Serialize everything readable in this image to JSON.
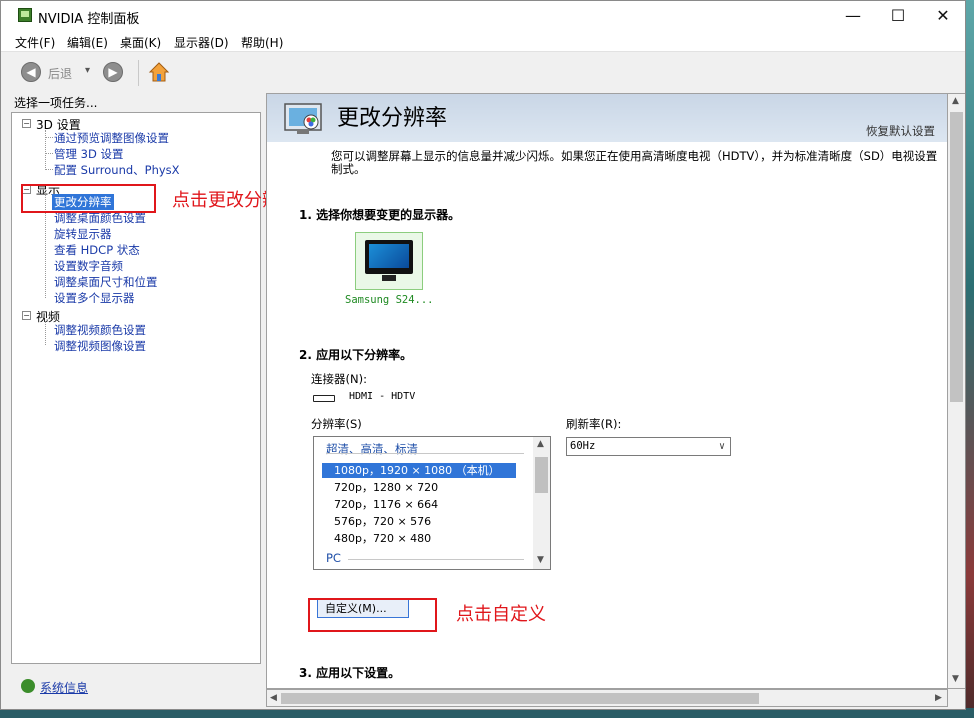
{
  "window": {
    "title": "NVIDIA 控制面板"
  },
  "titlebar_buttons": {
    "minimize": "—",
    "maximize": "☐",
    "close": "✕"
  },
  "menu": [
    "文件(F)",
    "编辑(E)",
    "桌面(K)",
    "显示器(D)",
    "帮助(H)"
  ],
  "toolbar": {
    "back_label": "后退",
    "drop": "▾"
  },
  "left": {
    "header": "选择一项任务...",
    "groups": [
      {
        "label": "3D 设置",
        "toggle": "−",
        "items": [
          "通过预览调整图像设置",
          "管理 3D 设置",
          "配置 Surround、PhysX"
        ]
      },
      {
        "label": "显示",
        "toggle": "−",
        "items": [
          "更改分辨率",
          "调整桌面颜色设置",
          "旋转显示器",
          "查看 HDCP 状态",
          "设置数字音频",
          "调整桌面尺寸和位置",
          "设置多个显示器"
        ]
      },
      {
        "label": "视频",
        "toggle": "−",
        "items": [
          "调整视频颜色设置",
          "调整视频图像设置"
        ]
      }
    ],
    "system_info": "系统信息"
  },
  "annotations": {
    "change_resolution": "点击更改分辨率",
    "custom": "点击自定义"
  },
  "main": {
    "title": "更改分辨率",
    "restore_defaults": "恢复默认设置",
    "description": "您可以调整屏幕上显示的信息量并减少闪烁。如果您正在使用高清晰度电视（HDTV），并为标准清晰度（SD）电视设置",
    "description2": "制式。",
    "section1": "1. 选择你想要变更的显示器。",
    "monitor_label": "Samsung S24...",
    "section2": "2. 应用以下分辨率。",
    "connector_label": "连接器(N):",
    "connector_value": "HDMI - HDTV",
    "resolution_label": "分辨率(S)",
    "resolution_group": "超清、高清、标清",
    "resolutions": [
      "1080p，1920 × 1080 （本机）",
      "720p，1280 × 720",
      "720p，1176 × 664",
      "576p，720 × 576",
      "480p，720 × 480"
    ],
    "resolution_group2": "PC",
    "refresh_label": "刷新率(R):",
    "refresh_value": "60Hz",
    "custom_button": "自定义(M)...",
    "section3": "3. 应用以下设置。"
  },
  "colors": {
    "accent": "#3075d8",
    "annotation": "#e0161b",
    "link": "#1a3aa8",
    "header_band": "#c9d6e6"
  }
}
